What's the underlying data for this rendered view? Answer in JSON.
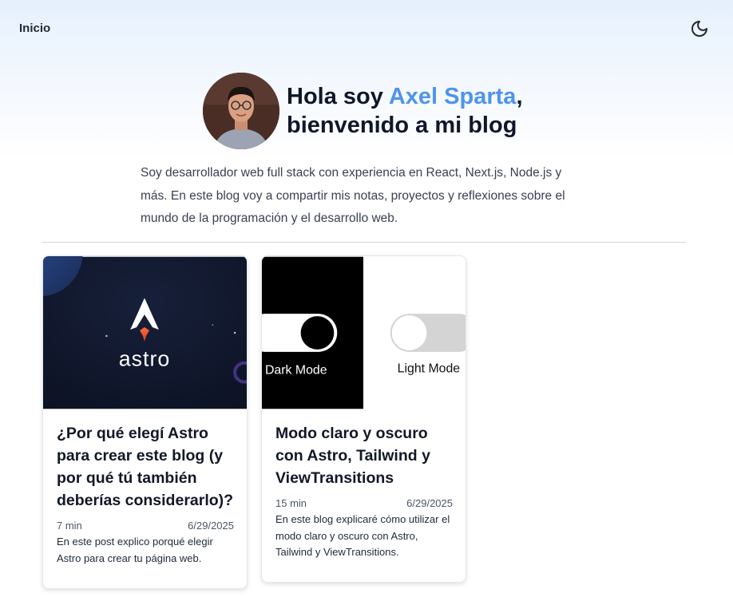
{
  "nav": {
    "home_label": "Inicio",
    "theme_icon": "moon-icon"
  },
  "hero": {
    "greeting": "Hola soy ",
    "name": "Axel Sparta",
    "comma": ",",
    "welcome": "bienvenido a mi blog",
    "accent_color": "#4f94ec"
  },
  "intro": "Soy desarrollador web full stack con experiencia en React, Next.js, Node.js y más. En este blog voy a compartir mis notas, proyectos y reflexiones sobre el mundo de la programación y el desarrollo web.",
  "posts": [
    {
      "title": "¿Por qué elegí Astro para crear este blog (y por qué tú también deberías considerarlo)?",
      "read_time": "7 min",
      "date": "6/29/2025",
      "description": "En este post explico porqué elegir Astro para crear tu página web.",
      "image_text": "astro"
    },
    {
      "title": "Modo claro y oscuro con Astro, Tailwind y ViewTransitions",
      "read_time": "15 min",
      "date": "6/29/2025",
      "description": "En este blog explicaré cómo utilizar el modo claro y oscuro con Astro, Tailwind y ViewTransitions.",
      "image_dark_label": "Dark Mode",
      "image_light_label": "Light Mode"
    }
  ]
}
